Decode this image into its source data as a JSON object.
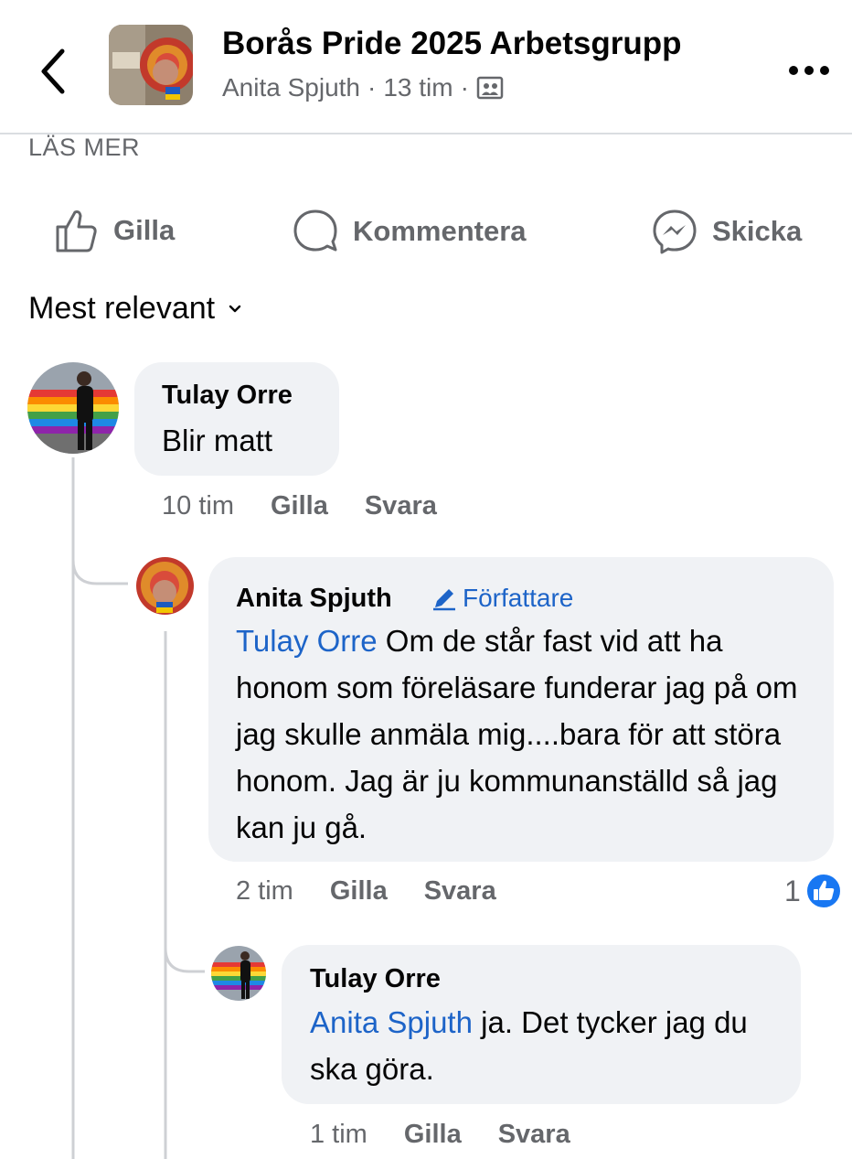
{
  "header": {
    "group_title": "Borås Pride 2025 Arbetsgrupp",
    "author": "Anita Spjuth",
    "separator": "·",
    "time": "13 tim",
    "audience_icon": "group-audience-icon"
  },
  "post": {
    "read_more": "LÄS MER"
  },
  "actions": {
    "like": "Gilla",
    "comment": "Kommentera",
    "send": "Skicka"
  },
  "sort": {
    "label": "Mest relevant"
  },
  "comments": [
    {
      "name": "Tulay Orre",
      "text": "Blir matt",
      "time": "10 tim",
      "like": "Gilla",
      "reply": "Svara"
    },
    {
      "name": "Anita Spjuth",
      "badge": "Författare",
      "mention": "Tulay Orre",
      "text": " Om de står fast vid att ha honom som föreläsare funderar jag på om jag skulle anmäla mig....bara för att störa honom. Jag är ju kommunanställd så jag kan ju gå.",
      "time": "2 tim",
      "like": "Gilla",
      "reply": "Svara",
      "reaction_count": "1"
    },
    {
      "name": "Tulay Orre",
      "mention": "Anita Spjuth",
      "text": " ja. Det tycker jag du ska göra.",
      "time": "1 tim",
      "like": "Gilla",
      "reply": "Svara"
    }
  ],
  "colors": {
    "mention": "#1d64c8",
    "meta": "#65676b",
    "bubble": "#f0f2f5",
    "like_badge": "#1877f2"
  }
}
